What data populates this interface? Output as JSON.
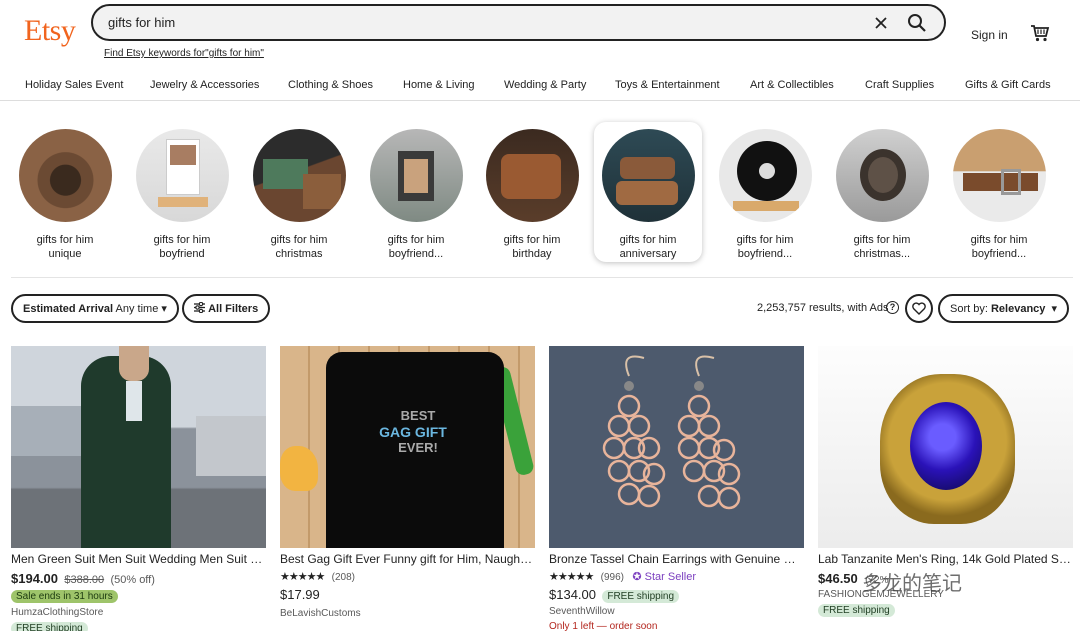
{
  "header": {
    "logo": "Etsy",
    "search_value": "gifts for him",
    "keywords_link": "Find Etsy keywords for\"gifts for him\"",
    "signin": "Sign in",
    "icons": [
      "clear-icon",
      "search-icon",
      "cart-icon"
    ]
  },
  "nav": {
    "categories": [
      "Holiday Sales Event",
      "Jewelry & Accessories",
      "Clothing & Shoes",
      "Home & Living",
      "Wedding & Party",
      "Toys & Entertainment",
      "Art & Collectibles",
      "Craft Supplies",
      "Gifts & Gift Cards"
    ]
  },
  "suggestions": [
    {
      "line1": "gifts for him",
      "line2": "unique"
    },
    {
      "line1": "gifts for him",
      "line2": "boyfriend"
    },
    {
      "line1": "gifts for him",
      "line2": "christmas"
    },
    {
      "line1": "gifts for him",
      "line2": "boyfriend..."
    },
    {
      "line1": "gifts for him",
      "line2": "birthday"
    },
    {
      "line1": "gifts for him",
      "line2": "anniversary"
    },
    {
      "line1": "gifts for him",
      "line2": "boyfriend..."
    },
    {
      "line1": "gifts for him",
      "line2": "christmas..."
    },
    {
      "line1": "gifts for him",
      "line2": "boyfriend..."
    }
  ],
  "filters": {
    "arrival_label": "Estimated Arrival",
    "arrival_value": "Any time",
    "all_filters": "All Filters",
    "results": "2,253,757 results, with Ads",
    "sort_label": "Sort by:",
    "sort_value": "Relevancy"
  },
  "listings": [
    {
      "title": "Men Green Suit Men Suit Wedding Men Suit Gr...",
      "price": "$194.00",
      "old_price": "$388.00",
      "discount": "(50% off)",
      "sale_badge": "Sale ends in 31 hours",
      "shop": "HumzaClothingStore",
      "shipping": "FREE shipping"
    },
    {
      "title": "Best Gag Gift Ever Funny gift for Him, Naughty ...",
      "stars": "★★★★★",
      "reviews": "(208)",
      "price": "$17.99",
      "shop": "BeLavishCustoms",
      "image_text_1": "BEST",
      "image_text_2": "GAG GIFT",
      "image_text_3": "EVER!"
    },
    {
      "title": "Bronze Tassel Chain Earrings with Genuine Dia...",
      "stars": "★★★★★",
      "reviews": "(996)",
      "star_seller": "Star Seller",
      "price": "$134.00",
      "shipping": "FREE shipping",
      "shop": "SeventhWillow",
      "stock": "Only 1 left — order soon"
    },
    {
      "title": "Lab Tanzanite Men's Ring, 14k Gold Plated Silve...",
      "price": "$46.50",
      "reviews": "(72%",
      "shop": "FASHIONGEMJEWELLERY",
      "shipping": "FREE shipping"
    }
  ],
  "watermark": "多龙的笔记",
  "colors": {
    "brand": "#F1641E",
    "sale": "#9EC46A",
    "shipping": "#D4E9D7",
    "star_seller": "#7B3FBF"
  }
}
